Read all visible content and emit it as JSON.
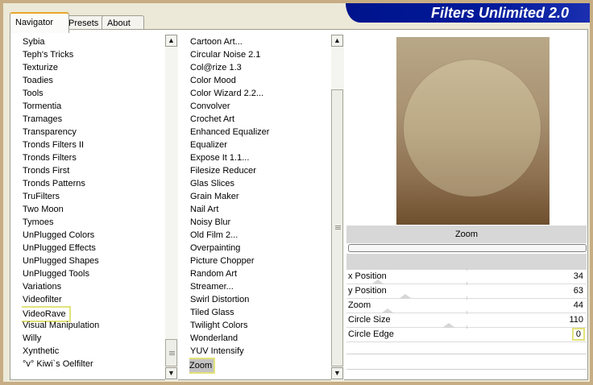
{
  "app": {
    "title": "Filters Unlimited 2.0"
  },
  "tabs": [
    {
      "label": "Navigator",
      "active": true
    },
    {
      "label": "Presets",
      "active": false
    },
    {
      "label": "About",
      "active": false
    }
  ],
  "categories": [
    "Sybia",
    "Teph's Tricks",
    "Texturize",
    "Toadies",
    "Tools",
    "Tormentia",
    "Tramages",
    "Transparency",
    "Tronds Filters II",
    "Tronds Filters",
    "Tronds First",
    "Tronds Patterns",
    "TruFilters",
    "Two Moon",
    "Tymoes",
    "UnPlugged Colors",
    "UnPlugged Effects",
    "UnPlugged Shapes",
    "UnPlugged Tools",
    "Variations",
    "Videofilter",
    "VideoRave",
    "Visual Manipulation",
    "Willy",
    "Xynthetic",
    "°v° Kiwi`s Oelfilter"
  ],
  "selected_category": "VideoRave",
  "filters": [
    "Cartoon Art...",
    "Circular Noise 2.1",
    "Col@rize 1.3",
    "Color Mood",
    "Color Wizard 2.2...",
    "Convolver",
    "Crochet Art",
    "Enhanced Equalizer",
    "Equalizer",
    "Expose It 1.1...",
    "Filesize Reducer",
    "Glas Slices",
    "Grain Maker",
    "Nail Art",
    "Noisy Blur",
    "Old Film 2...",
    "Overpainting",
    "Picture Chopper",
    "Random Art",
    "Streamer...",
    "Swirl Distortion",
    "Tiled Glass",
    "Twilight Colors",
    "Wonderland",
    "YUV Intensify",
    "Zoom"
  ],
  "selected_filter": "Zoom",
  "filter_panel": {
    "name": "Zoom",
    "params": [
      {
        "label": "x Position",
        "value": "34",
        "slider_fraction": 0.133
      },
      {
        "label": "y Position",
        "value": "63",
        "slider_fraction": 0.247
      },
      {
        "label": "Zoom",
        "value": "44",
        "slider_fraction": 0.173
      },
      {
        "label": "Circle Size",
        "value": "110",
        "slider_fraction": 0.431
      },
      {
        "label": "Circle Edge",
        "value": "0",
        "slider_fraction": 0.0
      }
    ]
  },
  "icons": {
    "scroll_up": "scroll-up-arrow-icon",
    "scroll_down": "scroll-down-arrow-icon",
    "thumb_grip": "grip-icon"
  },
  "colors": {
    "banner": "#00138c",
    "highlight_border": "#e2e27a",
    "selection": "#c3c3c3",
    "preview_dark": "#6e4f2e",
    "preview_light": "#c9b996"
  }
}
